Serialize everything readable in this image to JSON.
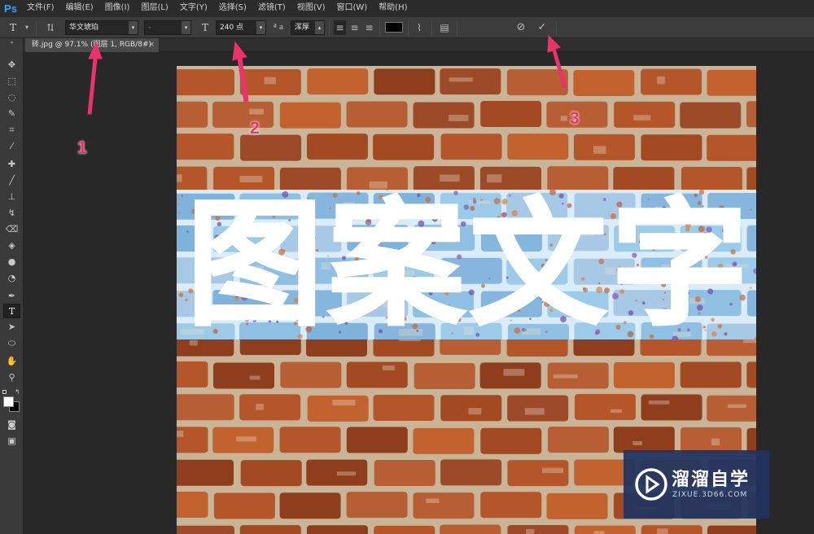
{
  "app": {
    "logo": "Ps"
  },
  "menu": [
    "文件(F)",
    "编辑(E)",
    "图像(I)",
    "图层(L)",
    "文字(Y)",
    "选择(S)",
    "滤镜(T)",
    "视图(V)",
    "窗口(W)",
    "帮助(H)"
  ],
  "options": {
    "font_family": "华文琥珀",
    "font_style": "-",
    "font_size": "240 点",
    "aa_label": "ª a",
    "antialias": "浑厚",
    "cancel_icon": "⊘",
    "commit_icon": "✓"
  },
  "document": {
    "tab_title": "砖.jpg @ 97.1% (图层 1, RGB/8#)",
    "close": "×"
  },
  "canvas_text": [
    "图",
    "案",
    "文",
    "字"
  ],
  "annotations": {
    "n1": "1",
    "n2": "2",
    "n3": "3",
    "color": "#e8336b"
  },
  "watermark": {
    "title": "溜溜自学",
    "url": "ZIXUE.3D66.COM"
  },
  "colors": {
    "foreground": "#ffffff",
    "background": "#000000",
    "text_color_swatch": "#000000"
  }
}
